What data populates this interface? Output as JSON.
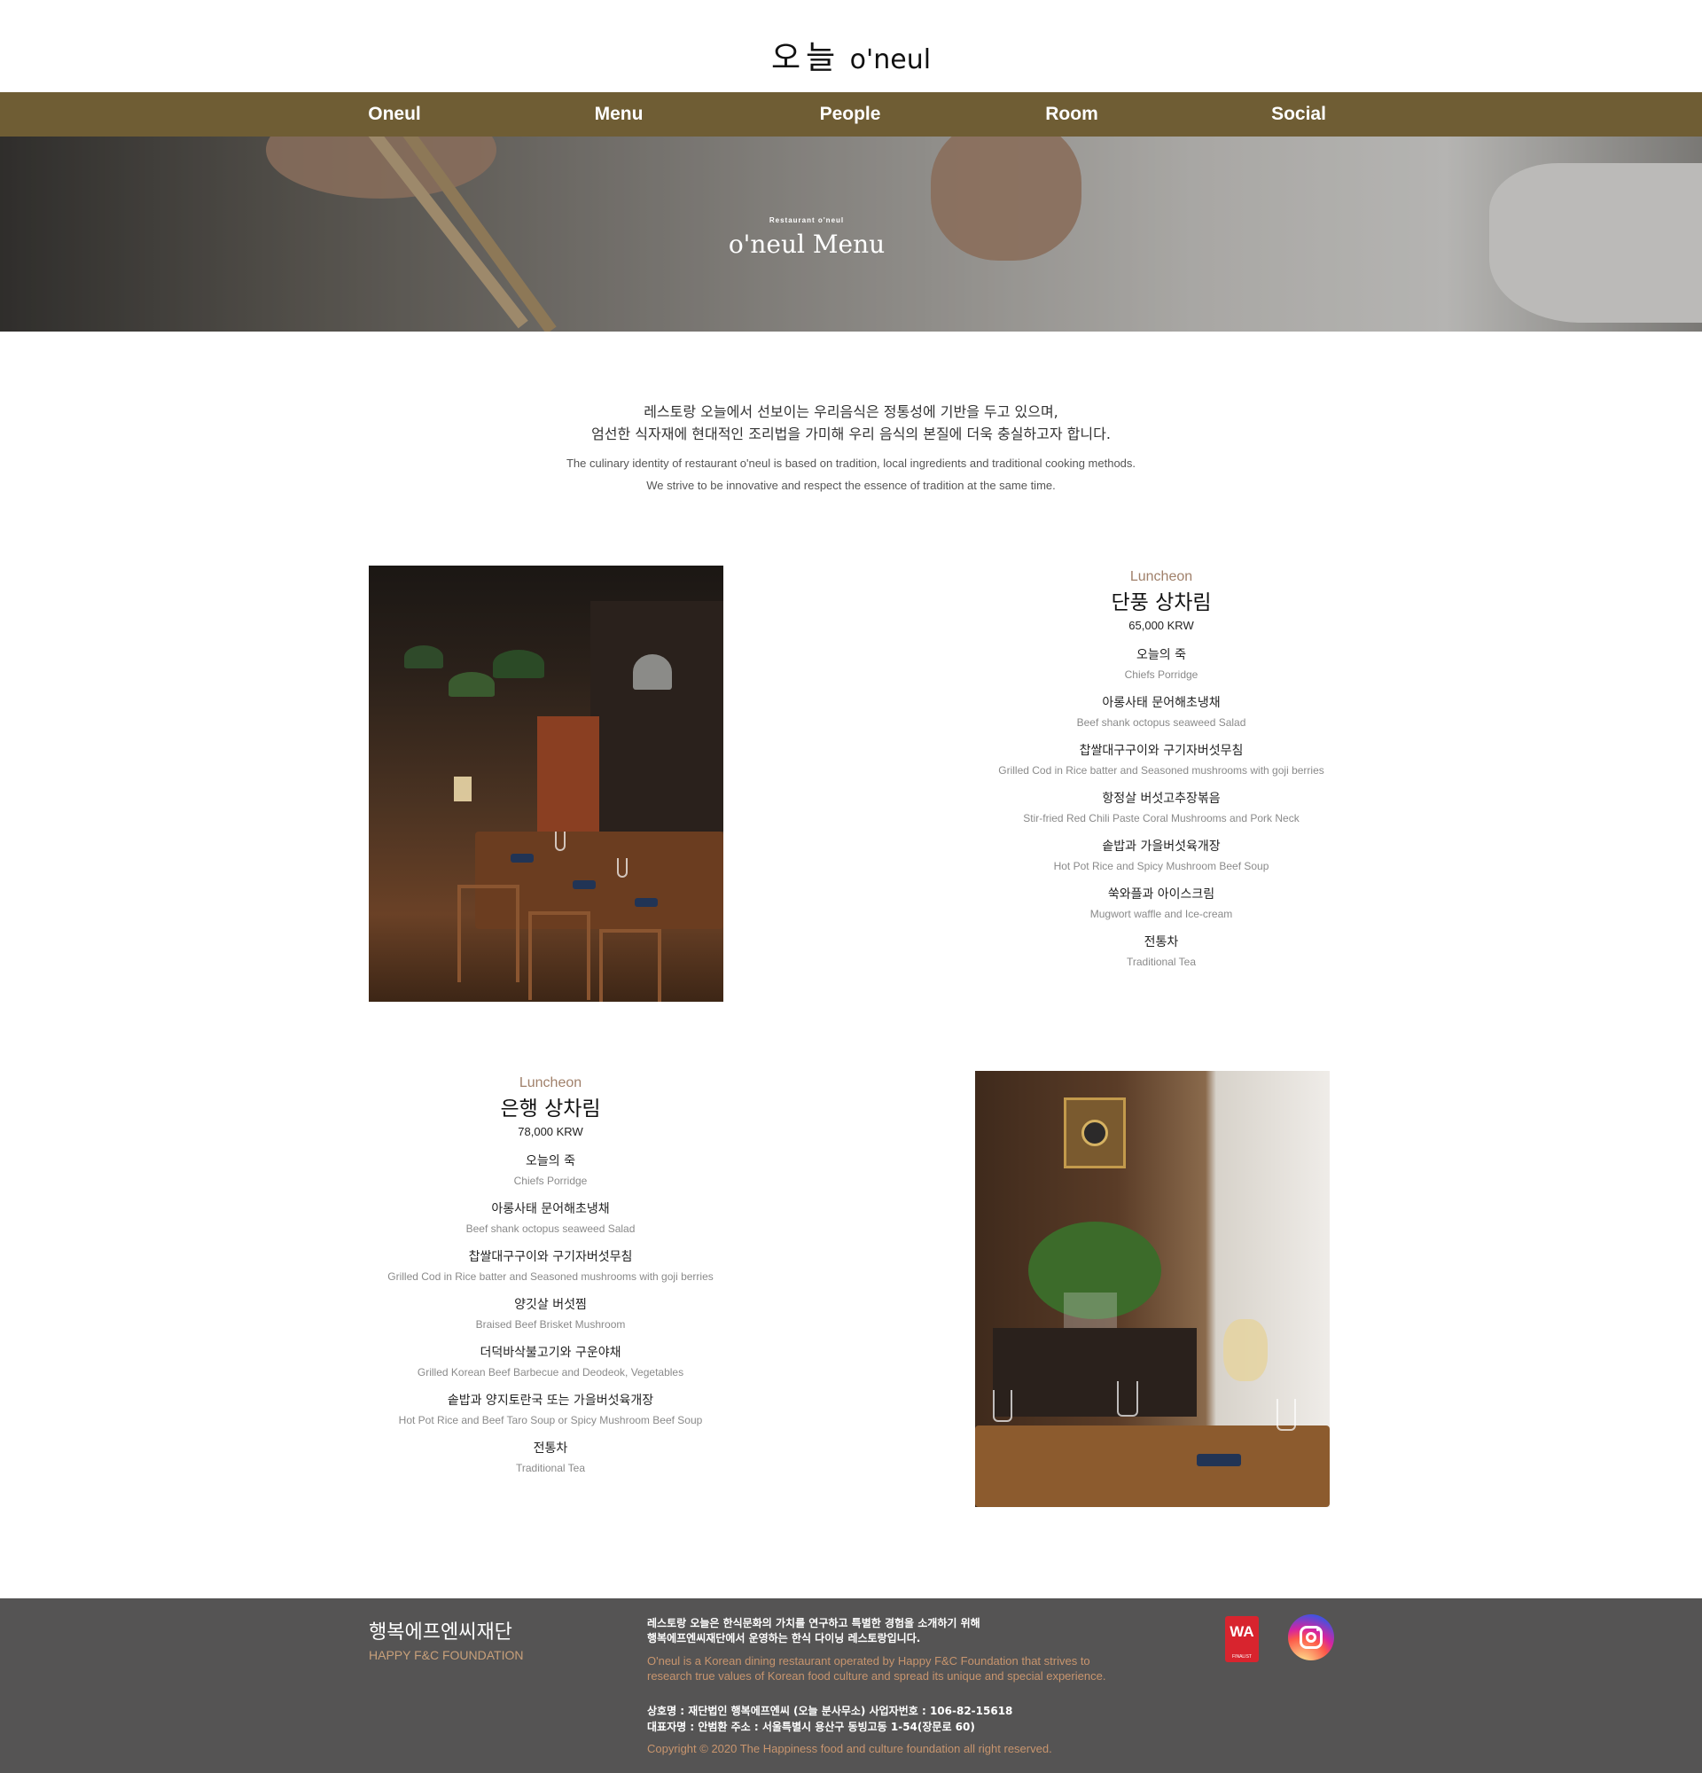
{
  "header": {
    "logo_ko": "오늘",
    "logo_en": "o'neul"
  },
  "nav": {
    "items": [
      {
        "label": "Oneul"
      },
      {
        "label": "Menu"
      },
      {
        "label": "People"
      },
      {
        "label": "Room"
      },
      {
        "label": "Social"
      }
    ]
  },
  "hero": {
    "subtitle": "Restaurant o'neul",
    "title": "o'neul Menu"
  },
  "intro": {
    "ko_line1": "레스토랑 오늘에서 선보이는 우리음식은 정통성에 기반을 두고 있으며,",
    "ko_line2": "엄선한 식자재에 현대적인 조리법을 가미해 우리 음식의 본질에 더욱 충실하고자 합니다.",
    "en_line1": "The culinary identity of restaurant o'neul is based on tradition, local ingredients and traditional cooking methods.",
    "en_line2": "We strive to be innovative and respect the essence of tradition at the same time."
  },
  "menus": [
    {
      "category": "Luncheon",
      "title": "단풍 상차림",
      "price": "65,000 KRW",
      "dishes": [
        {
          "ko": "오늘의 죽",
          "en": "Chiefs Porridge"
        },
        {
          "ko": "아롱사태 문어해초냉채",
          "en": "Beef shank octopus seaweed Salad"
        },
        {
          "ko": "찹쌀대구구이와 구기자버섯무침",
          "en": "Grilled Cod in Rice batter and Seasoned mushrooms with goji berries"
        },
        {
          "ko": "항정살 버섯고추장볶음",
          "en": "Stir-fried Red Chili Paste Coral Mushrooms and Pork Neck"
        },
        {
          "ko": "솥밥과 가을버섯육개장",
          "en": "Hot Pot Rice and Spicy Mushroom Beef Soup"
        },
        {
          "ko": "쑥와플과 아이스크림",
          "en": "Mugwort waffle and Ice-cream"
        },
        {
          "ko": "전통차",
          "en": "Traditional Tea"
        }
      ]
    },
    {
      "category": "Luncheon",
      "title": "은행 상차림",
      "price": "78,000 KRW",
      "dishes": [
        {
          "ko": "오늘의 죽",
          "en": "Chiefs Porridge"
        },
        {
          "ko": "아롱사태 문어해초냉채",
          "en": "Beef shank octopus seaweed Salad"
        },
        {
          "ko": "찹쌀대구구이와 구기자버섯무침",
          "en": "Grilled Cod in Rice batter and Seasoned mushrooms with goji berries"
        },
        {
          "ko": "양깃살 버섯찜",
          "en": "Braised Beef Brisket Mushroom"
        },
        {
          "ko": "더덕바삭불고기와 구운야채",
          "en": "Grilled Korean Beef Barbecue and Deodeok, Vegetables"
        },
        {
          "ko": "솥밥과 양지토란국 또는 가을버섯육개장",
          "en": "Hot Pot Rice and Beef Taro Soup or Spicy Mushroom Beef Soup"
        },
        {
          "ko": "전통차",
          "en": "Traditional Tea"
        }
      ]
    }
  ],
  "footer": {
    "name_ko": "행복에프엔씨재단",
    "name_en": "HAPPY F&C FOUNDATION",
    "desc_ko_1": "레스토랑 오늘은 한식문화의 가치를 연구하고 특별한 경험을 소개하기 위해",
    "desc_ko_2": "행복에프엔씨재단에서 운영하는 한식 다이닝 레스토랑입니다.",
    "desc_en_1": "O'neul is a Korean dining restaurant operated by Happy F&C Foundation that strives to",
    "desc_en_2": "research true values of Korean food culture and spread its unique and special experience.",
    "biz_1": "상호명 : 재단법인 행복에프엔씨 (오늘 분사무소) 사업자번호 : 106-82-15618",
    "biz_2": "대표자명 : 안범환 주소 : 서울특별시 용산구 동빙고동 1-54(장문로 60)",
    "copyright": "Copyright © 2020 The Happiness food and culture foundation all right reserved.",
    "badge_text": "WA",
    "badge_sub": "FINALIST",
    "instagram_icon": "instagram-icon"
  }
}
